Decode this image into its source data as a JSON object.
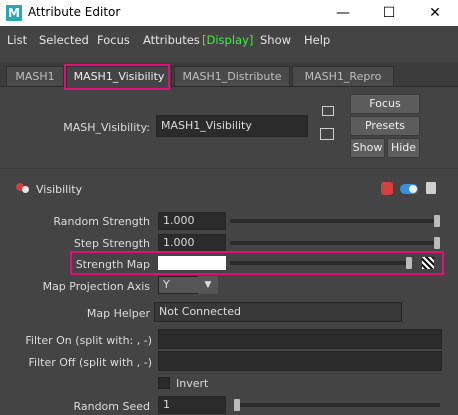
{
  "window": {
    "title": "Attribute Editor",
    "app_icon": "M"
  },
  "menu": [
    "List",
    "Selected",
    "Focus",
    "Attributes",
    "[Display]",
    "Show",
    "Help"
  ],
  "tabs": [
    "MASH1",
    "MASH1_Visibility",
    "MASH1_Distribute",
    "MASH1_Repro"
  ],
  "node": {
    "label": "MASH_Visibility:",
    "value": "MASH1_Visibility"
  },
  "side_buttons": {
    "focus": "Focus",
    "presets": "Presets",
    "show": "Show",
    "hide": "Hide"
  },
  "section": {
    "title": "Visibility"
  },
  "attributes": {
    "random_strength": {
      "label": "Random Strength",
      "value": "1.000",
      "slider_fraction": 1.0
    },
    "step_strength": {
      "label": "Step Strength",
      "value": "1.000",
      "slider_fraction": 1.0
    },
    "strength_map": {
      "label": "Strength Map",
      "slider_fraction": 1.0
    },
    "map_projection_axis": {
      "label": "Map Projection Axis",
      "value": "Y"
    },
    "map_helper": {
      "label": "Map Helper",
      "value": "Not Connected"
    },
    "filter_on": {
      "label": "Filter On (split with: , -)",
      "value": ""
    },
    "filter_off": {
      "label": "Filter Off (split with , -)",
      "value": ""
    },
    "invert": {
      "label": "Invert",
      "checked": false
    },
    "random_seed": {
      "label": "Random Seed",
      "value": "1",
      "slider_fraction": 0.0
    }
  },
  "colors": {
    "highlight": "#e0107a",
    "display_menu": "#3bf03b",
    "background": "#444444"
  }
}
